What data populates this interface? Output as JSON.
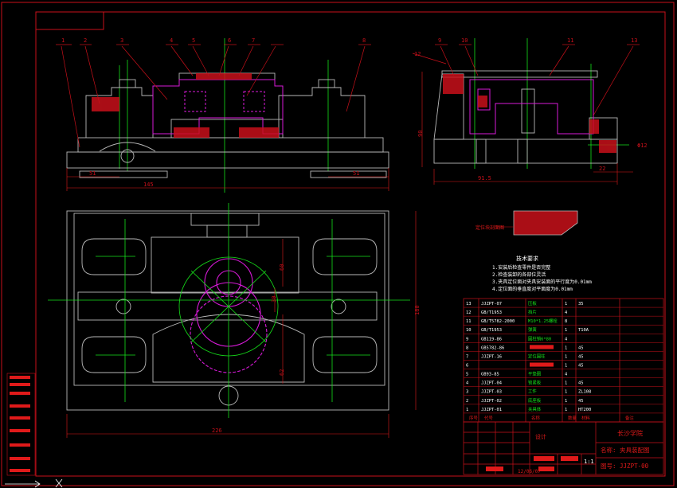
{
  "colors": {
    "background": "#000000",
    "frame": "#c8101a",
    "outline": "#b8b8b8",
    "center_line": "#16e01a",
    "part_highlight": "#d81ad8",
    "hatch": "#c8101a",
    "text_white": "#ffffff",
    "text_green": "#16e01a",
    "dimension": "#e01a1a"
  },
  "balloons_top": [
    "1",
    "2",
    "3",
    "4",
    "5",
    "6",
    "7",
    "8"
  ],
  "balloons_side": [
    "9",
    "10",
    "11",
    "12"
  ],
  "balloon_13": "13",
  "dims": {
    "front_left": "51",
    "front_total": "145",
    "front_right": "51",
    "side_height": "90",
    "side_width": "91.5",
    "side_right": "22",
    "side_hole": "Φ12",
    "plan_width": "226",
    "plan_height": "180",
    "plan_d1": "60",
    "plan_d2": "30",
    "plan_d3": "62"
  },
  "section_label": "定位块剖面图",
  "tech_requirements": {
    "title": "技术要求",
    "items": [
      "1.安装后检查零件是否完整",
      "2.检查装卸的各部位灵活",
      "3.夹具定位面对夹具安装面的平行度为0.01mm",
      "4.定位面的垂直度对平面度为0.01mm"
    ]
  },
  "bom": {
    "rows": [
      {
        "no": "13",
        "code": "JJZPT-07",
        "name": "压板",
        "qty": "1",
        "material": "35",
        "note": ""
      },
      {
        "no": "12",
        "code": "GB/T1953",
        "name": "挡片",
        "qty": "4",
        "material": "",
        "note": ""
      },
      {
        "no": "11",
        "code": "GB/T5782-2000",
        "name": "M10*1.25螺栓",
        "qty": "8",
        "material": "",
        "note": ""
      },
      {
        "no": "10",
        "code": "GB/T1953",
        "name": "弹簧",
        "qty": "1",
        "material": "T10A",
        "note": ""
      },
      {
        "no": "9",
        "code": "GB119-86",
        "name": "圆柱销6*80",
        "qty": "4",
        "material": "",
        "note": ""
      },
      {
        "no": "8",
        "code": "GB5782-86",
        "name": "",
        "qty": "1",
        "material": "45",
        "note": ""
      },
      {
        "no": "7",
        "code": "JJZPT-16",
        "name": "定位圆柱",
        "qty": "1",
        "material": "45",
        "note": ""
      },
      {
        "no": "6",
        "code": "",
        "name": "",
        "qty": "1",
        "material": "45",
        "note": ""
      },
      {
        "no": "5",
        "code": "GB93-85",
        "name": "平垫圈",
        "qty": "4",
        "material": "",
        "note": ""
      },
      {
        "no": "4",
        "code": "JJZPT-04",
        "name": "锁紧板",
        "qty": "1",
        "material": "45",
        "note": ""
      },
      {
        "no": "3",
        "code": "JJZPT-03",
        "name": "工件",
        "qty": "1",
        "material": "ZL108",
        "note": ""
      },
      {
        "no": "2",
        "code": "JJZPT-02",
        "name": "底座板",
        "qty": "1",
        "material": "45",
        "note": ""
      },
      {
        "no": "1",
        "code": "JJZPT-01",
        "name": "夹具体",
        "qty": "1",
        "material": "HT200",
        "note": ""
      }
    ],
    "header": {
      "no": "序号",
      "code": "代号",
      "name": "名称",
      "qty": "数量",
      "material": "材料",
      "note": "备注"
    }
  },
  "title_block": {
    "school": "长沙学院",
    "drawing_name": "名称: 夹具装配图",
    "drawing_no": "图号: JJZPT-00",
    "designer_label": "设计",
    "scale": "1:1",
    "date": "12/06/07"
  }
}
